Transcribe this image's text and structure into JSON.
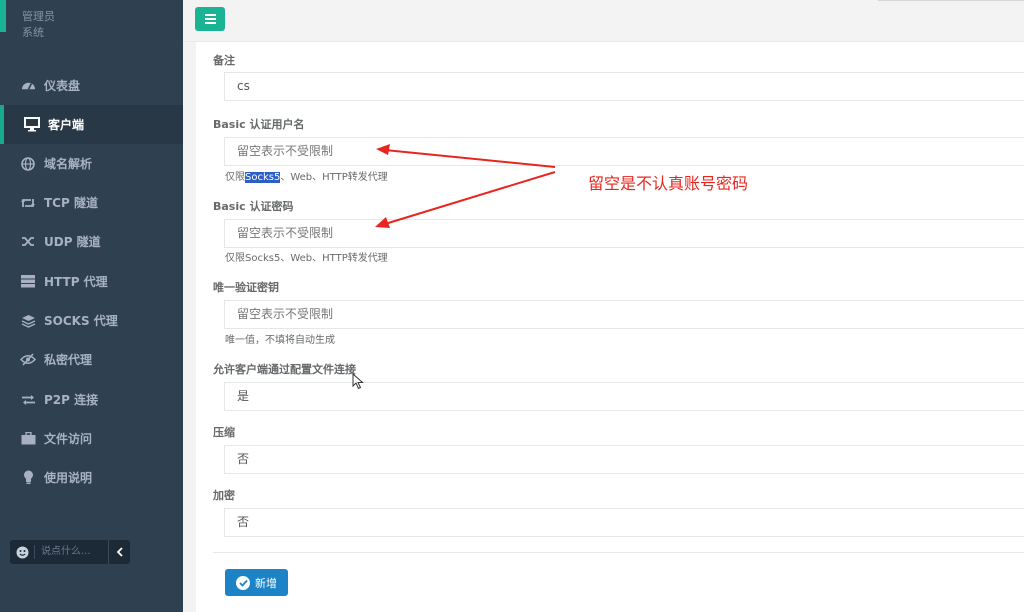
{
  "sidebar": {
    "user": {
      "role": "管理员",
      "system": "系统"
    },
    "items": [
      {
        "label": "仪表盘",
        "icon": "dashboard-icon"
      },
      {
        "label": "客户端",
        "icon": "desktop-icon"
      },
      {
        "label": "域名解析",
        "icon": "globe-icon"
      },
      {
        "label": "TCP 隧道",
        "icon": "retweet-icon"
      },
      {
        "label": "UDP 隧道",
        "icon": "random-icon"
      },
      {
        "label": "HTTP 代理",
        "icon": "server-icon"
      },
      {
        "label": "SOCKS 代理",
        "icon": "layers-icon"
      },
      {
        "label": "私密代理",
        "icon": "eye-slash-icon"
      },
      {
        "label": "P2P 连接",
        "icon": "exchange-icon"
      },
      {
        "label": "文件访问",
        "icon": "briefcase-icon"
      },
      {
        "label": "使用说明",
        "icon": "lightbulb-icon"
      }
    ],
    "active_index": 1,
    "chat": {
      "placeholder": "说点什么..."
    }
  },
  "form": {
    "remark": {
      "label": "备注",
      "value": "cs"
    },
    "basic_user": {
      "label": "Basic 认证用户名",
      "placeholder": "留空表示不受限制",
      "help_prefix": "仅限",
      "help_highlight": "Socks5",
      "help_suffix": "、Web、HTTP转发代理"
    },
    "basic_pass": {
      "label": "Basic 认证密码",
      "placeholder": "留空表示不受限制",
      "help": "仅限Socks5、Web、HTTP转发代理"
    },
    "vkey": {
      "label": "唯一验证密钥",
      "placeholder": "留空表示不受限制",
      "help": "唯一值，不填将自动生成"
    },
    "config_conn": {
      "label": "允许客户端通过配置文件连接",
      "value": "是"
    },
    "compress": {
      "label": "压缩",
      "value": "否"
    },
    "crypt": {
      "label": "加密",
      "value": "否"
    },
    "submit_label": "新增"
  },
  "annotation": {
    "text": "留空是不认真账号密码",
    "color": "#e8261f"
  },
  "colors": {
    "sidebar_bg": "#2f4050",
    "accent": "#1ab394",
    "primary_button": "#1c84c6"
  }
}
